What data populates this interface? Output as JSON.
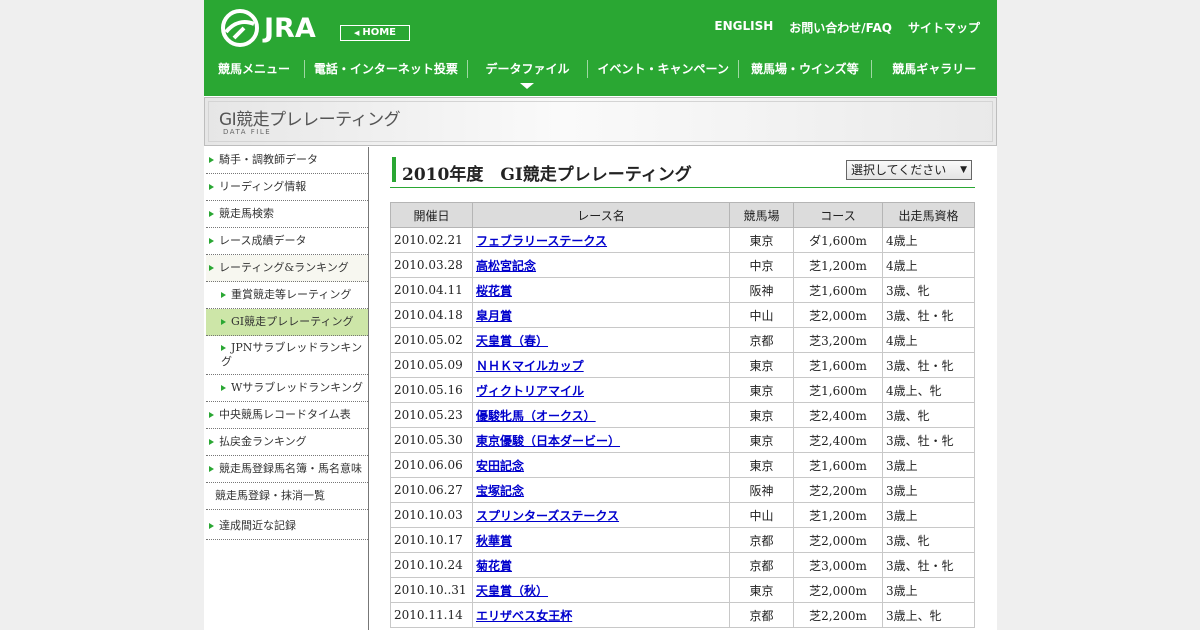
{
  "header": {
    "logo_text": "JRA",
    "home_label": "HOME",
    "top_links": [
      "ENGLISH",
      "お問い合わせ/FAQ",
      "サイトマップ"
    ],
    "nav": [
      "競馬メニュー",
      "電話・インターネット投票",
      "データファイル",
      "イベント・キャンペーン",
      "競馬場・ウインズ等",
      "競馬ギャラリー"
    ],
    "nav_current": "データファイル"
  },
  "banner": {
    "title": "GI競走プレレーティング",
    "subtitle": "DATA FILE"
  },
  "sidebar": {
    "items": [
      {
        "label": "騎手・調教師データ"
      },
      {
        "label": "リーディング情報"
      },
      {
        "label": "競走馬検索"
      },
      {
        "label": "レース成績データ"
      },
      {
        "label": "レーティング&ランキング"
      },
      {
        "label": "重賞競走等レーティング"
      },
      {
        "label": "GI競走プレレーティング"
      },
      {
        "label": "JPNサラブレッドランキング"
      },
      {
        "label": "Wサラブレッドランキング"
      },
      {
        "label": "中央競馬レコードタイム表"
      },
      {
        "label": "払戻金ランキング"
      },
      {
        "label": "競走馬登録馬名簿・馬名意味"
      },
      {
        "label": "競走馬登録・抹消一覧"
      },
      {
        "label": "達成間近な記録"
      }
    ]
  },
  "main": {
    "heading": "2010年度　GI競走プレレーティング",
    "select_value": "選択してください",
    "table": {
      "headers": [
        "開催日",
        "レース名",
        "競馬場",
        "コース",
        "出走馬資格"
      ],
      "rows": [
        [
          "2010.02.21",
          "フェブラリーステークス",
          "東京",
          "ダ1,600m",
          "4歳上"
        ],
        [
          "2010.03.28",
          "高松宮記念",
          "中京",
          "芝1,200m",
          "4歳上"
        ],
        [
          "2010.04.11",
          "桜花賞",
          "阪神",
          "芝1,600m",
          "3歳、牝"
        ],
        [
          "2010.04.18",
          "皐月賞",
          "中山",
          "芝2,000m",
          "3歳、牡・牝"
        ],
        [
          "2010.05.02",
          "天皇賞（春）",
          "京都",
          "芝3,200m",
          "4歳上"
        ],
        [
          "2010.05.09",
          "ＮＨＫマイルカップ",
          "東京",
          "芝1,600m",
          "3歳、牡・牝"
        ],
        [
          "2010.05.16",
          "ヴィクトリアマイル",
          "東京",
          "芝1,600m",
          "4歳上、牝"
        ],
        [
          "2010.05.23",
          "優駿牝馬（オークス）",
          "東京",
          "芝2,400m",
          "3歳、牝"
        ],
        [
          "2010.05.30",
          "東京優駿（日本ダービー）",
          "東京",
          "芝2,400m",
          "3歳、牡・牝"
        ],
        [
          "2010.06.06",
          "安田記念",
          "東京",
          "芝1,600m",
          "3歳上"
        ],
        [
          "2010.06.27",
          "宝塚記念",
          "阪神",
          "芝2,200m",
          "3歳上"
        ],
        [
          "2010.10.03",
          "スプリンターズステークス",
          "中山",
          "芝1,200m",
          "3歳上"
        ],
        [
          "2010.10.17",
          "秋華賞",
          "京都",
          "芝2,000m",
          "3歳、牝"
        ],
        [
          "2010.10.24",
          "菊花賞",
          "京都",
          "芝3,000m",
          "3歳、牡・牝"
        ],
        [
          "2010.10..31",
          "天皇賞（秋）",
          "東京",
          "芝2,000m",
          "3歳上"
        ],
        [
          "2010.11.14",
          "エリザベス女王杯",
          "京都",
          "芝2,200m",
          "3歳上、牝"
        ]
      ]
    }
  },
  "colors": {
    "brand_green": "#2aa733",
    "link_blue": "#0000cc",
    "active_side": "#cde6a8"
  }
}
